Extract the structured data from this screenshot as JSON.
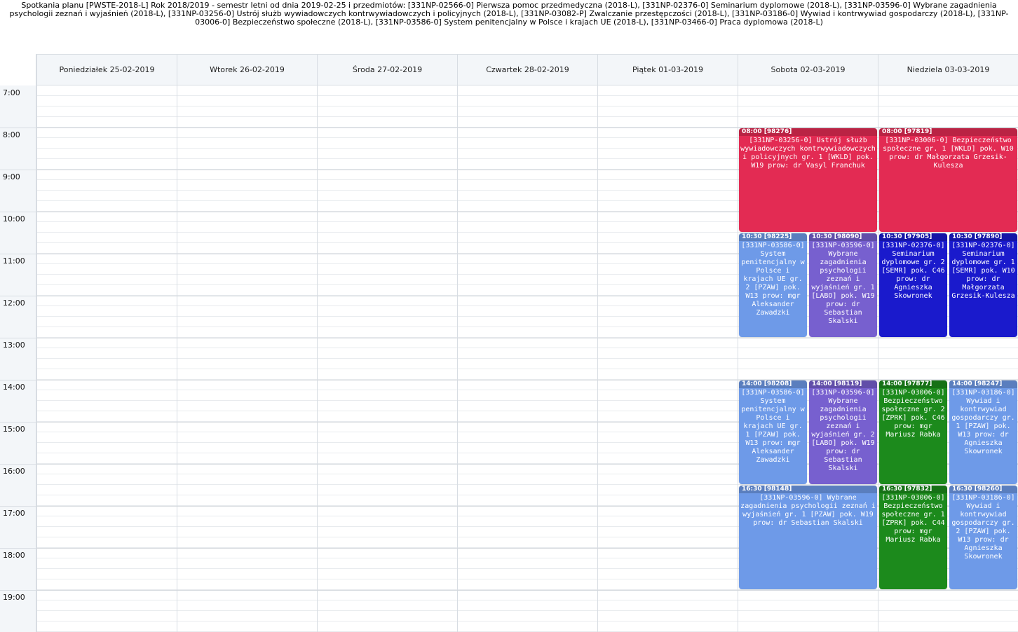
{
  "header": {
    "title": "Spotkania planu [PWSTE-2018-L] Rok 2018/2019 - semestr letni od dnia 2019-02-25 i przedmiotów: [331NP-02566-0] Pierwsza pomoc przedmedyczna (2018-L), [331NP-02376-0] Seminarium dyplomowe (2018-L), [331NP-03596-0] Wybrane zagadnienia psychologii zeznań i wyjaśnień (2018-L), [331NP-03256-0] Ustrój służb wywiadowczych kontrwywiadowczych i policyjnych (2018-L), [331NP-03082-P] Zwalczanie przestępczości (2018-L), [331NP-03186-0] Wywiad i kontrwywiad gospodarczy (2018-L), [331NP-03006-0] Bezpieczeństwo społeczne (2018-L), [331NP-03586-0] System penitencjalny w Polsce i krajach UE (2018-L), [331NP-03466-0] Praca dyplomowa (2018-L)"
  },
  "days": [
    "Poniedziałek 25-02-2019",
    "Wtorek 26-02-2019",
    "Środa 27-02-2019",
    "Czwartek 28-02-2019",
    "Piątek 01-03-2019",
    "Sobota 02-03-2019",
    "Niedziela 03-03-2019"
  ],
  "hours": [
    "7:00",
    "8:00",
    "9:00",
    "10:00",
    "11:00",
    "12:00",
    "13:00",
    "14:00",
    "15:00",
    "16:00",
    "17:00",
    "18:00",
    "19:00"
  ],
  "colors": {
    "crimson": "#e32b53",
    "lightblue": "#6e9ae8",
    "purple": "#7760cf",
    "blue": "#1a1acc",
    "green": "#1c8a1c"
  },
  "events": [
    {
      "day": 5,
      "start": "08:00",
      "end": "10:30",
      "lane": 0,
      "lanes": 1,
      "color": "crimson",
      "header": "08:00 [98276]",
      "text": "[331NP-03256-0] Ustrój służb wywiadowczych kontrwywiadowczych i policyjnych gr. 1 [WKLD] pok. W19 prow: dr Vasyl Franchuk"
    },
    {
      "day": 6,
      "start": "08:00",
      "end": "10:30",
      "lane": 0,
      "lanes": 1,
      "color": "crimson",
      "header": "08:00 [97819]",
      "text": "[331NP-03006-0] Bezpieczeństwo społeczne gr. 1 [WKLD] pok. W10 prow: dr Małgorzata Grzesik-Kulesza"
    },
    {
      "day": 5,
      "start": "10:30",
      "end": "13:00",
      "lane": 0,
      "lanes": 2,
      "color": "lightblue",
      "header": "10:30 [98225]",
      "text": "[331NP-03586-0] System penitencjalny w Polsce i krajach UE gr. 2 [PZAW] pok. W13 prow: mgr Aleksander Zawadzki"
    },
    {
      "day": 5,
      "start": "10:30",
      "end": "13:00",
      "lane": 1,
      "lanes": 2,
      "color": "purple",
      "header": "10:30 [98090]",
      "text": "[331NP-03596-0] Wybrane zagadnienia psychologii zeznań i wyjaśnień gr. 1 [LABO] pok. W19 prow: dr Sebastian Skalski"
    },
    {
      "day": 6,
      "start": "10:30",
      "end": "13:00",
      "lane": 0,
      "lanes": 2,
      "color": "blue",
      "header": "10:30 [97905]",
      "text": "[331NP-02376-0] Seminarium dyplomowe gr. 2 [SEMR] pok. C46 prow: dr Agnieszka Skowronek"
    },
    {
      "day": 6,
      "start": "10:30",
      "end": "13:00",
      "lane": 1,
      "lanes": 2,
      "color": "blue",
      "header": "10:30 [97890]",
      "text": "[331NP-02376-0] Seminarium dyplomowe gr. 1 [SEMR] pok. W10 prow: dr Małgorzata Grzesik-Kulesza"
    },
    {
      "day": 5,
      "start": "14:00",
      "end": "16:30",
      "lane": 0,
      "lanes": 2,
      "color": "lightblue",
      "header": "14:00 [98208]",
      "text": "[331NP-03586-0] System penitencjalny w Polsce i krajach UE gr. 1 [PZAW] pok. W13 prow: mgr Aleksander Zawadzki"
    },
    {
      "day": 5,
      "start": "14:00",
      "end": "16:30",
      "lane": 1,
      "lanes": 2,
      "color": "purple",
      "header": "14:00 [98119]",
      "text": "[331NP-03596-0] Wybrane zagadnienia psychologii zeznań i wyjaśnień gr. 2 [LABO] pok. W19 prow: dr Sebastian Skalski"
    },
    {
      "day": 6,
      "start": "14:00",
      "end": "16:30",
      "lane": 0,
      "lanes": 2,
      "color": "green",
      "header": "14:00 [97877]",
      "text": "[331NP-03006-0] Bezpieczeństwo społeczne gr. 2 [ZPRK] pok. C46 prow: mgr Mariusz Rabka"
    },
    {
      "day": 6,
      "start": "14:00",
      "end": "16:30",
      "lane": 1,
      "lanes": 2,
      "color": "lightblue",
      "header": "14:00 [98247]",
      "text": "[331NP-03186-0] Wywiad i kontrwywiad gospodarczy gr. 1 [PZAW] pok. W13 prow: dr Agnieszka Skowronek"
    },
    {
      "day": 5,
      "start": "16:30",
      "end": "19:00",
      "lane": 0,
      "lanes": 1,
      "color": "lightblue",
      "header": "16:30 [98148]",
      "text": "[331NP-03596-0] Wybrane zagadnienia psychologii zeznań i wyjaśnień gr. 1 [PZAW] pok. W19 prow: dr Sebastian Skalski"
    },
    {
      "day": 6,
      "start": "16:30",
      "end": "19:00",
      "lane": 0,
      "lanes": 2,
      "color": "green",
      "header": "16:30 [97832]",
      "text": "[331NP-03006-0] Bezpieczeństwo społeczne gr. 1 [ZPRK] pok. C44 prow: mgr Mariusz Rabka"
    },
    {
      "day": 6,
      "start": "16:30",
      "end": "19:00",
      "lane": 1,
      "lanes": 2,
      "color": "lightblue",
      "header": "16:30 [98260]",
      "text": "[331NP-03186-0] Wywiad i kontrwywiad gospodarczy gr. 2 [PZAW] pok. W13 prow: dr Agnieszka Skowronek"
    }
  ]
}
